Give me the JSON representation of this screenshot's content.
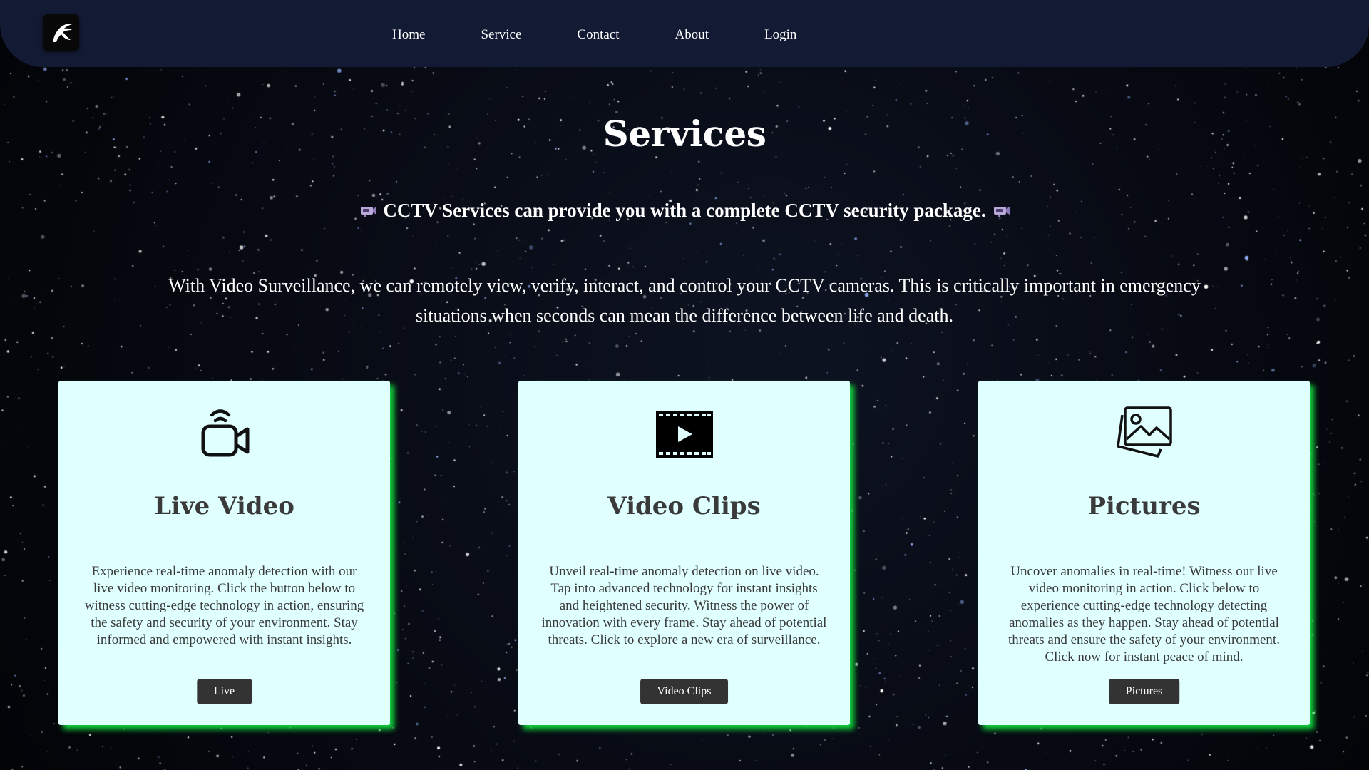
{
  "nav": {
    "items": [
      {
        "label": "Home"
      },
      {
        "label": "Service"
      },
      {
        "label": "Contact"
      },
      {
        "label": "About"
      },
      {
        "label": "Login"
      }
    ]
  },
  "hero": {
    "title": "Services",
    "subtitle_text": "CCTV Services can provide you with a complete CCTV security package.",
    "subtitle_icon": "cctv-camera-icon",
    "intro": "With Video Surveillance, we can remotely view, verify, interact, and control your CCTV cameras. This is critically important in emergency situations when seconds can mean the difference between life and death."
  },
  "cards": [
    {
      "icon": "video-camera-icon",
      "title": "Live Video",
      "text": "Experience real-time anomaly detection with our live video monitoring. Click the button below to witness cutting-edge technology in action, ensuring the safety and security of your environment. Stay informed and empowered with instant insights.",
      "button": "Live"
    },
    {
      "icon": "film-play-icon",
      "title": "Video Clips",
      "text": "Unveil real-time anomaly detection on live video. Tap into advanced technology for instant insights and heightened security. Witness the power of innovation with every frame. Stay ahead of potential threats. Click to explore a new era of surveillance.",
      "button": "Video Clips"
    },
    {
      "icon": "pictures-icon",
      "title": "Pictures",
      "text": "Uncover anomalies in real-time! Witness our live video monitoring in action. Click below to experience cutting-edge technology detecting anomalies as they happen. Stay ahead of potential threats and ensure the safety of your environment. Click now for instant peace of mind.",
      "button": "Pictures"
    }
  ],
  "colors": {
    "navbar": "#131a33",
    "card_background": "#e0ffff",
    "card_glow": "#11d23b",
    "button": "#333333"
  }
}
